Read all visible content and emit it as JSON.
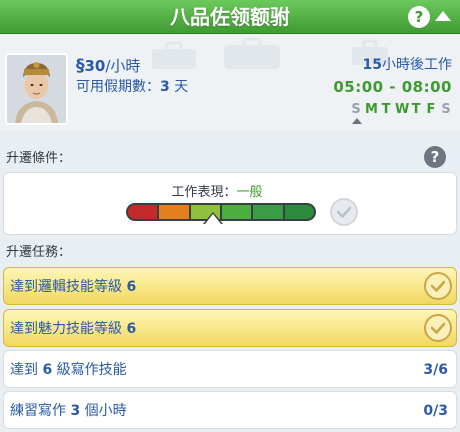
{
  "header": {
    "title": "八品佐领额驸"
  },
  "job": {
    "currency_symbol": "§",
    "wage_amount": "30",
    "wage_unit": "/小時",
    "leave_label": "可用假期數：",
    "leave_days": "3",
    "leave_unit": " 天",
    "hours_until": "15",
    "hours_until_suffix": "小時後工作",
    "hours": "05:00 - 08:00",
    "days": [
      {
        "letter": "S",
        "active": false
      },
      {
        "letter": "M",
        "active": true
      },
      {
        "letter": "T",
        "active": true
      },
      {
        "letter": "W",
        "active": true
      },
      {
        "letter": "T",
        "active": true
      },
      {
        "letter": "F",
        "active": true
      },
      {
        "letter": "S",
        "active": false
      }
    ]
  },
  "promotion": {
    "section_label": "升遷條件：",
    "performance_label": "工作表現：",
    "performance_value": "一般",
    "performance_level": 0.46,
    "segment_colors": [
      "#c42a2a",
      "#e47f1f",
      "#8fc23a",
      "#4cae3f",
      "#3a9d45",
      "#2b8a3c"
    ]
  },
  "tasks": {
    "section_label": "升遷任務：",
    "items": [
      {
        "prefix": "達到邏輯技能等級 ",
        "bold": "6",
        "suffix": "",
        "progress": "",
        "completed": true
      },
      {
        "prefix": "達到魅力技能等級 ",
        "bold": "6",
        "suffix": "",
        "progress": "",
        "completed": true
      },
      {
        "prefix": "達到 ",
        "bold": "6",
        "suffix": " 級寫作技能",
        "progress": "3/6",
        "completed": false
      },
      {
        "prefix": "練習寫作 ",
        "bold": "3",
        "suffix": " 個小時",
        "progress": "0/3",
        "completed": false
      }
    ]
  },
  "colors": {
    "accent_green": "#3d9b2d",
    "text_blue": "#2a5aa8",
    "completed_gold": "#f1d860"
  },
  "icons": {
    "help": "question-mark-icon",
    "collapse": "caret-up-icon",
    "check": "checkmark-icon"
  }
}
